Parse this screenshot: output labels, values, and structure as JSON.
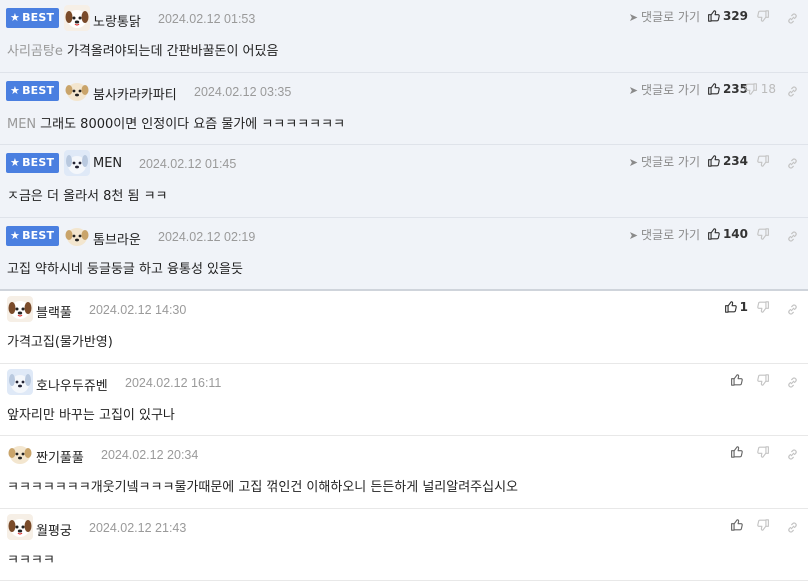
{
  "best_label": "BEST",
  "reply_label": "댓글로 가기",
  "comments": [
    {
      "best": true,
      "nickname": "노랑통닭",
      "avatar": "dog-white",
      "date": "2024.02.12 01:53",
      "likes": "329",
      "dislikes": "",
      "mention": "사리곰탕e",
      "text": "가격올려야되는데 간판바꿀돈이 어딨음"
    },
    {
      "best": true,
      "nickname": "붐사카라카파티",
      "avatar": "dog-tan",
      "date": "2024.02.12 03:35",
      "likes": "235",
      "dislikes": "18",
      "mention": "MEN",
      "text": "그래도 8000이면 인정이다 요즘 물가에 ㅋㅋㅋㅋㅋㅋㅋ"
    },
    {
      "best": true,
      "nickname": "MEN",
      "avatar": "dog-blue",
      "date": "2024.02.12 01:45",
      "likes": "234",
      "dislikes": "",
      "mention": "",
      "text": "ㅈ금은 더 올라서 8천 됨 ㅋㅋ"
    },
    {
      "best": true,
      "nickname": "톰브라운",
      "avatar": "dog-tan",
      "date": "2024.02.12 02:19",
      "likes": "140",
      "dislikes": "",
      "mention": "",
      "text": "고집 약하시네 둥글둥글 하고 융통성 있을듯"
    },
    {
      "best": false,
      "nickname": "블랙풀",
      "avatar": "dog-white",
      "date": "2024.02.12 14:30",
      "likes": "1",
      "dislikes": "",
      "mention": "",
      "text": "가격고집(물가반영)"
    },
    {
      "best": false,
      "nickname": "호나우두쥬벤",
      "avatar": "dog-blue",
      "date": "2024.02.12 16:11",
      "likes": "",
      "dislikes": "",
      "mention": "",
      "text": "앞자리만 바꾸는 고집이 있구나"
    },
    {
      "best": false,
      "nickname": "짠기풀풀",
      "avatar": "dog-tan",
      "date": "2024.02.12 20:34",
      "likes": "",
      "dislikes": "",
      "mention": "",
      "text": "ㅋㅋㅋㅋㅋㅋㅋ개웃기넼ㅋㅋㅋ물가때문에 고집 꺾인건 이해하오니 든든하게 널리알려주십시오"
    },
    {
      "best": false,
      "nickname": "월평궁",
      "avatar": "dog-white",
      "date": "2024.02.12 21:43",
      "likes": "",
      "dislikes": "",
      "mention": "",
      "text": "ㅋㅋㅋㅋ"
    }
  ]
}
